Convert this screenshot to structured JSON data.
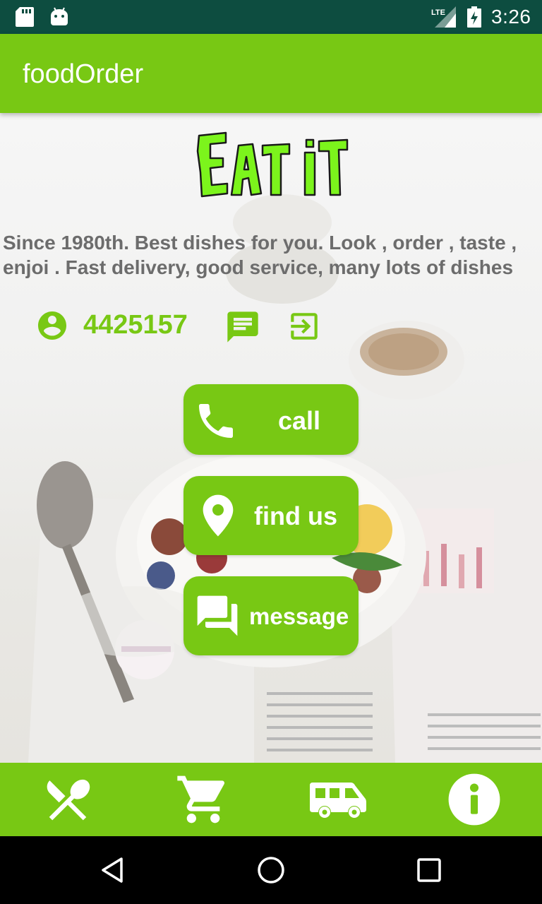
{
  "status_bar": {
    "time": "3:26",
    "network": "LTE",
    "icons": [
      "sd-card-icon",
      "android-icon",
      "lte-signal-icon",
      "battery-charging-icon"
    ]
  },
  "app_bar": {
    "title": "foodOrder"
  },
  "main": {
    "logo_text": "Eat it",
    "tagline": "Since 1980th. Best dishes for you. Look , order , taste , enjoi . Fast delivery, good service, many lots of dishes",
    "phone": "4425157",
    "info_icons": [
      "account-circle-icon",
      "chat-icon",
      "exit-to-app-icon"
    ],
    "buttons": {
      "call": "call",
      "find_us": "find us",
      "message": "message"
    }
  },
  "bottom_nav": {
    "items": [
      {
        "icon": "restaurant-icon"
      },
      {
        "icon": "cart-icon"
      },
      {
        "icon": "delivery-truck-icon"
      },
      {
        "icon": "info-icon"
      }
    ]
  },
  "system_nav": {
    "icons": [
      "back-icon",
      "home-icon",
      "recents-icon"
    ]
  },
  "colors": {
    "primary": "#78c814",
    "status_bar": "#0d4d40",
    "logo": "#7cf41c",
    "tagline": "#6c6c6c"
  }
}
